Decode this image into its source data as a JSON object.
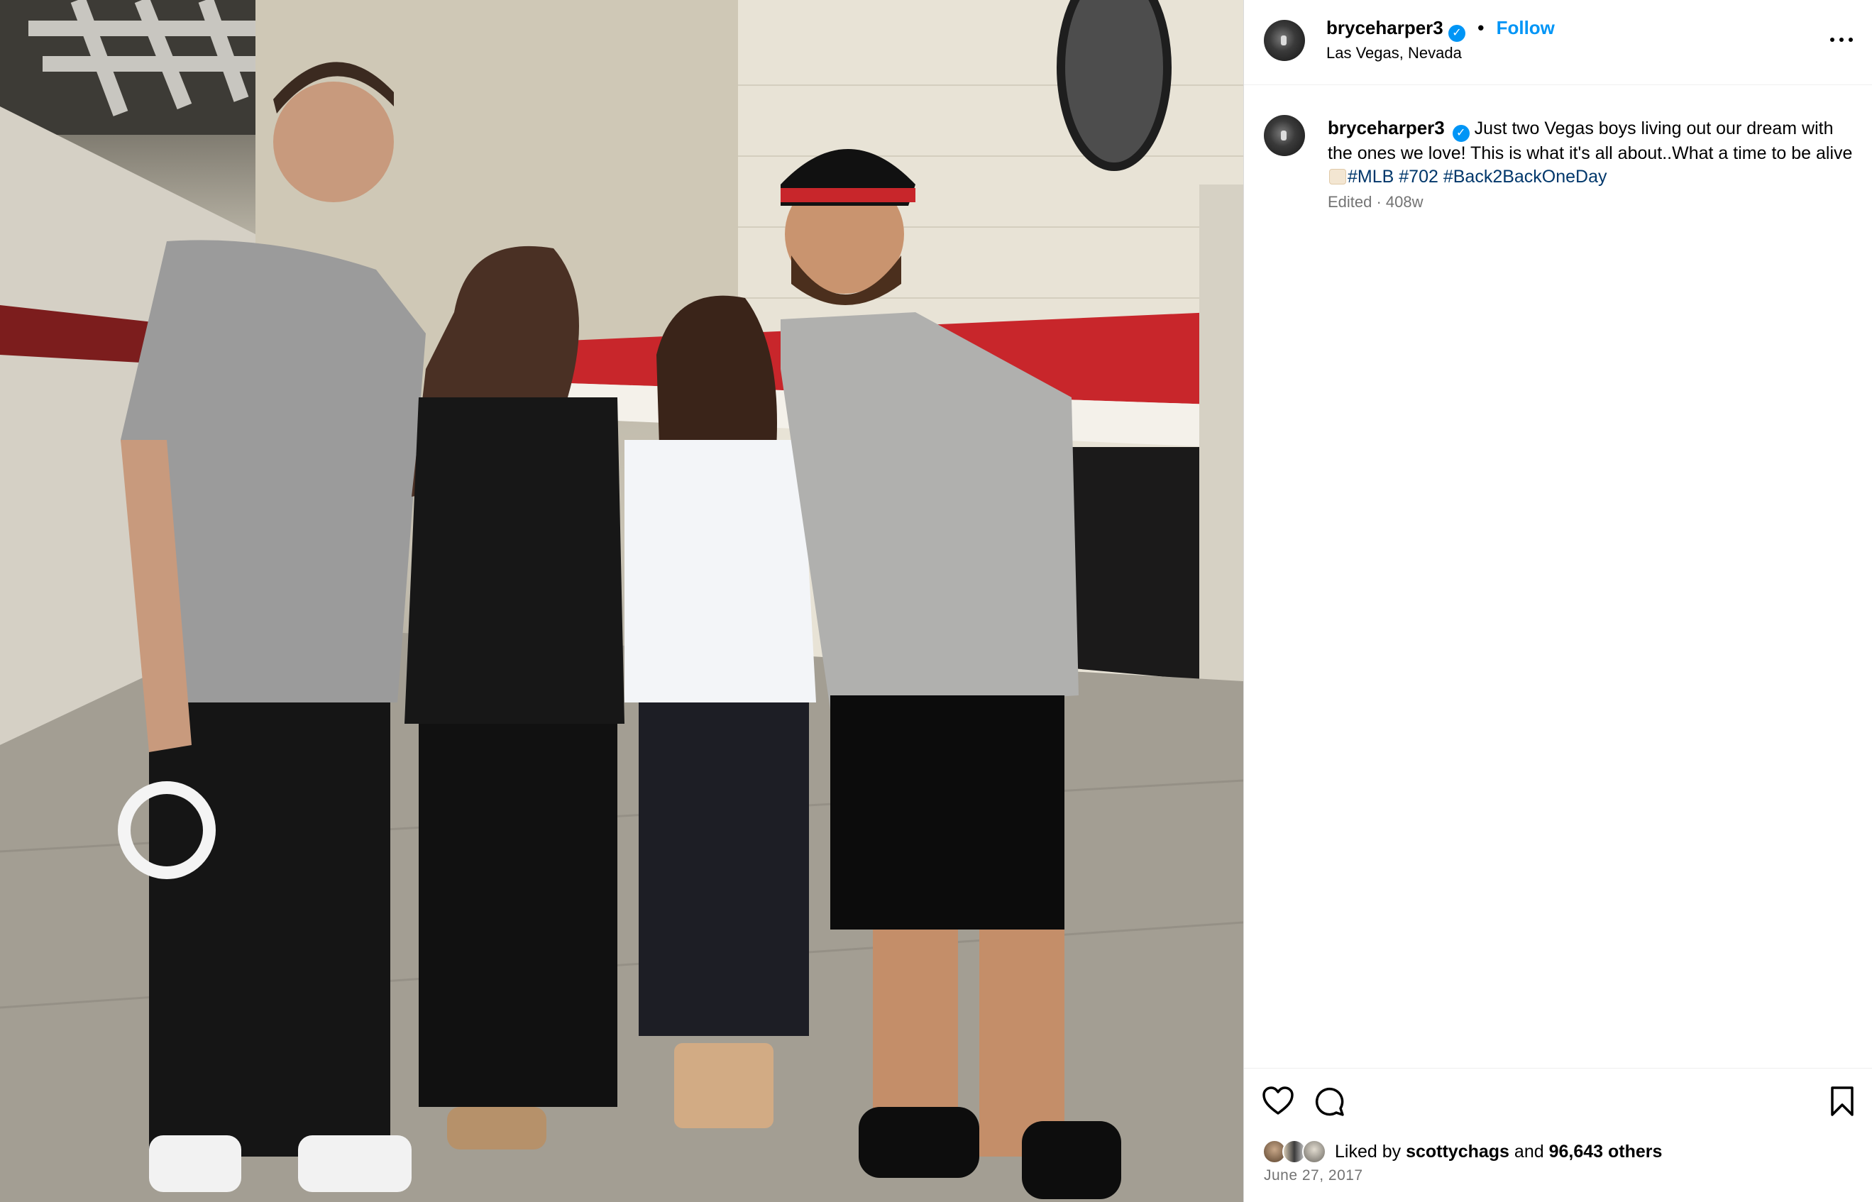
{
  "post": {
    "username": "bryceharper3",
    "verified_symbol": "✓",
    "separator": "•",
    "follow_label": "Follow",
    "location": "Las Vegas, Nevada",
    "photo_description_alt": ""
  },
  "caption": {
    "username": "bryceharper3",
    "text": "Just two Vegas boys living out our dream with the ones we love! This is what it's all about..What a time to be alive",
    "hashtags": [
      "#MLB",
      "#702",
      "#Back2BackOneDay"
    ],
    "edited_meta": "Edited · 408w"
  },
  "engagement": {
    "liked_by_prefix": "Liked by",
    "liked_by_user": "scottychags",
    "and_label": "and",
    "others_label": "96,643 others",
    "date": "June 27, 2017"
  },
  "icons": {
    "more": "more-options-icon",
    "like": "heart-icon",
    "comment": "comment-icon",
    "save": "bookmark-icon",
    "verified": "verified-badge-icon"
  },
  "colors": {
    "accent": "#0095f6",
    "hashtag": "#00376b",
    "muted": "#737373"
  }
}
